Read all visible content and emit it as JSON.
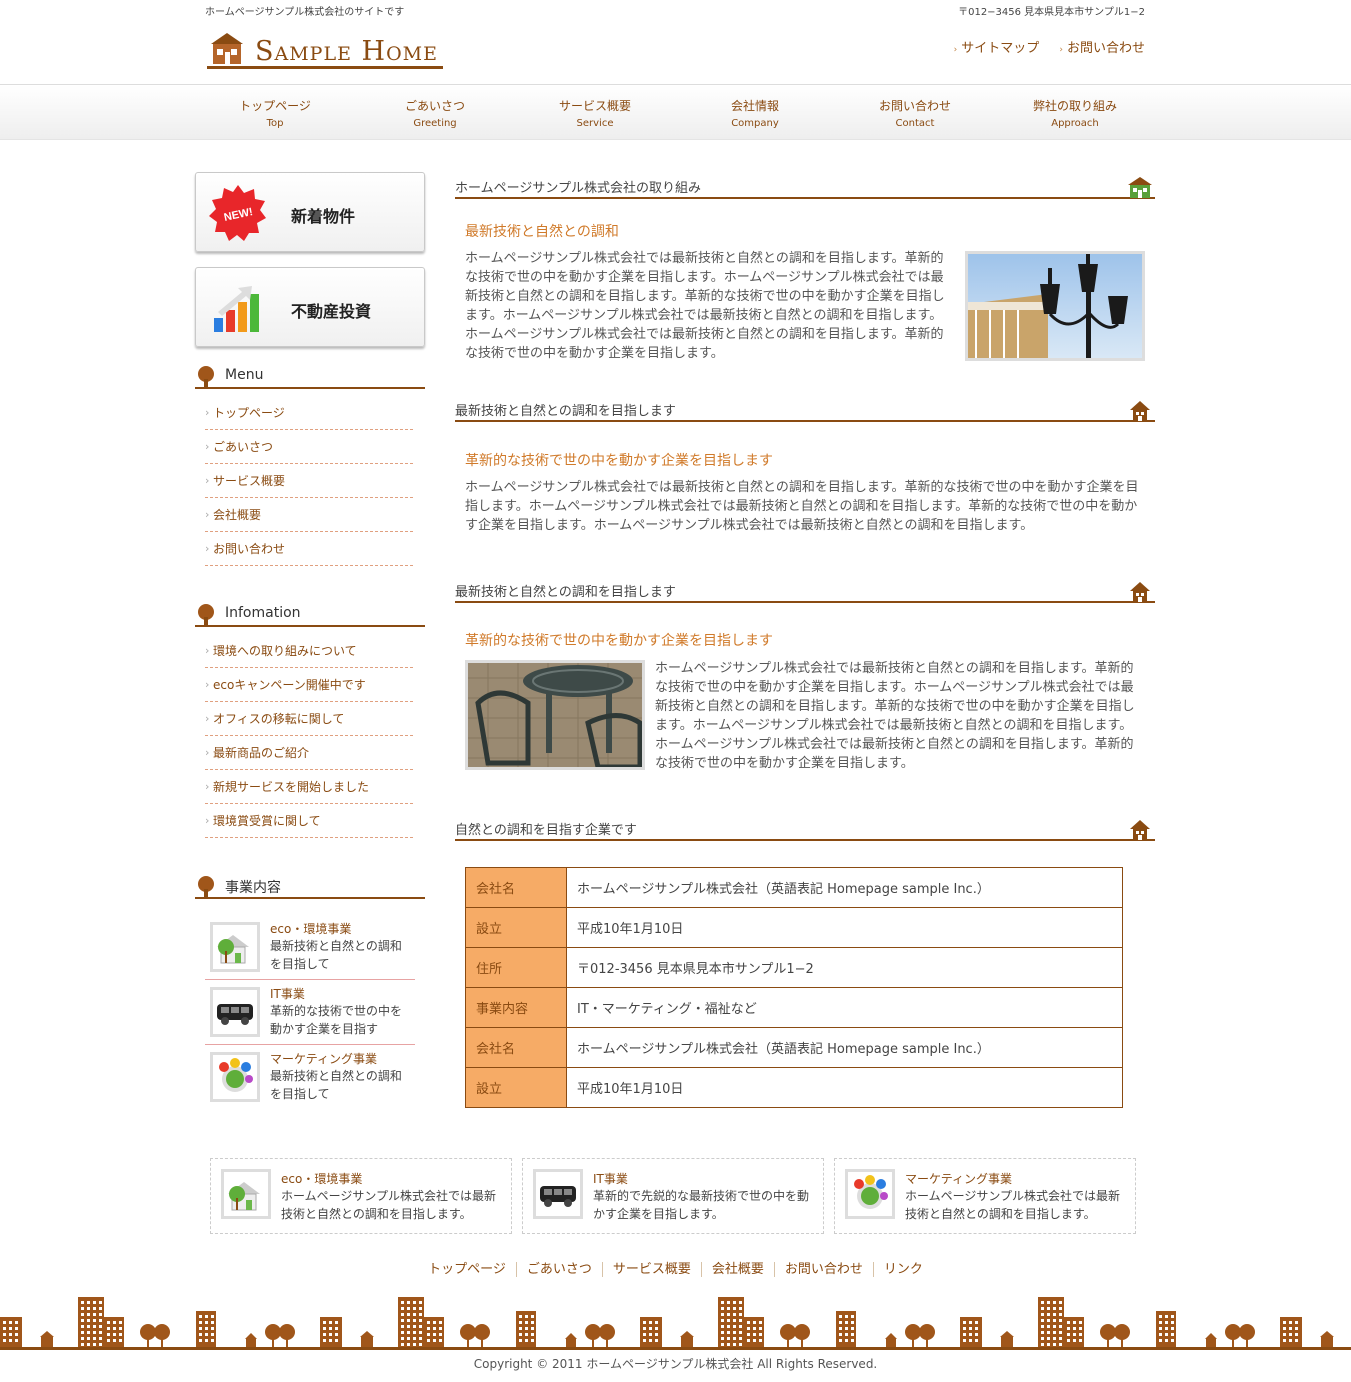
{
  "header": {
    "tagline": "ホームページサンプル株式会社のサイトです",
    "address": "〒012−3456 見本県見本市サンプル1−2",
    "logo_text": "Sample Home",
    "links": [
      "サイトマップ",
      "お問い合わせ"
    ]
  },
  "nav": [
    {
      "jp": "トップページ",
      "en": "Top"
    },
    {
      "jp": "ごあいさつ",
      "en": "Greeting"
    },
    {
      "jp": "サービス概要",
      "en": "Service"
    },
    {
      "jp": "会社情報",
      "en": "Company"
    },
    {
      "jp": "お問い合わせ",
      "en": "Contact"
    },
    {
      "jp": "弊社の取り組み",
      "en": "Approach"
    }
  ],
  "sidebar": {
    "banners": [
      {
        "badge": "NEW!",
        "label": "新着物件"
      },
      {
        "label": "不動産投資"
      }
    ],
    "menu_title": "Menu",
    "menu": [
      "トップページ",
      "ごあいさつ",
      "サービス概要",
      "会社概要",
      "お問い合わせ"
    ],
    "info_title": "Infomation",
    "info": [
      "環境への取り組みについて",
      "ecoキャンペーン開催中です",
      "オフィスの移転に関して",
      "最新商品のご紹介",
      "新規サービスを開始しました",
      "環境賞受賞に関して"
    ],
    "biz_title": "事業内容",
    "biz": [
      {
        "title": "eco・環境事業",
        "text": "最新技術と自然との調和を目指して"
      },
      {
        "title": "IT事業",
        "text": "革新的な技術で世の中を動かす企業を目指す"
      },
      {
        "title": "マーケティング事業",
        "text": "最新技術と自然との調和を目指して"
      }
    ]
  },
  "main": {
    "sec1": {
      "title": "ホームページサンプル株式会社の取り組み",
      "sub": "最新技術と自然との調和",
      "text": "ホームページサンプル株式会社では最新技術と自然との調和を目指します。革新的な技術で世の中を動かす企業を目指します。ホームページサンプル株式会社では最新技術と自然との調和を目指します。革新的な技術で世の中を動かす企業を目指します。ホームページサンプル株式会社では最新技術と自然との調和を目指します。ホームページサンプル株式会社では最新技術と自然との調和を目指します。革新的な技術で世の中を動かす企業を目指します。"
    },
    "sec2": {
      "title": "最新技術と自然との調和を目指します",
      "sub": "革新的な技術で世の中を動かす企業を目指します",
      "text": "ホームページサンプル株式会社では最新技術と自然との調和を目指します。革新的な技術で世の中を動かす企業を目指します。ホームページサンプル株式会社では最新技術と自然との調和を目指します。革新的な技術で世の中を動かす企業を目指します。ホームページサンプル株式会社では最新技術と自然との調和を目指します。"
    },
    "sec3": {
      "title": "最新技術と自然との調和を目指します",
      "sub": "革新的な技術で世の中を動かす企業を目指します",
      "text": "ホームページサンプル株式会社では最新技術と自然との調和を目指します。革新的な技術で世の中を動かす企業を目指します。ホームページサンプル株式会社では最新技術と自然との調和を目指します。革新的な技術で世の中を動かす企業を目指します。ホームページサンプル株式会社では最新技術と自然との調和を目指します。ホームページサンプル株式会社では最新技術と自然との調和を目指します。革新的な技術で世の中を動かす企業を目指します。"
    },
    "sec4": {
      "title": "自然との調和を目指す企業です",
      "table": [
        [
          "会社名",
          "ホームページサンプル株式会社（英語表記 Homepage sample Inc.）"
        ],
        [
          "設立",
          "平成10年1月10日"
        ],
        [
          "住所",
          "〒012-3456 見本県見本市サンプル1−2"
        ],
        [
          "事業内容",
          "IT・マーケティング・福祉など"
        ],
        [
          "会社名",
          "ホームページサンプル株式会社（英語表記 Homepage sample Inc.）"
        ],
        [
          "設立",
          "平成10年1月10日"
        ]
      ]
    }
  },
  "footer": {
    "boxes": [
      {
        "title": "eco・環境事業",
        "text": "ホームページサンプル株式会社では最新技術と自然との調和を目指します。"
      },
      {
        "title": "IT事業",
        "text": "革新的で先鋭的な最新技術で世の中を動かす企業を目指します。"
      },
      {
        "title": "マーケティング事業",
        "text": "ホームページサンプル株式会社では最新技術と自然との調和を目指します。"
      }
    ],
    "links": [
      "トップページ",
      "ごあいさつ",
      "サービス概要",
      "会社概要",
      "お問い合わせ",
      "リンク"
    ],
    "copyright": "Copyright © 2011 ホームページサンプル株式会社 All Rights Reserved."
  },
  "colors": {
    "brand": "#8a4b12",
    "accent": "#d07a2a",
    "table_key": "#f6ab66"
  }
}
